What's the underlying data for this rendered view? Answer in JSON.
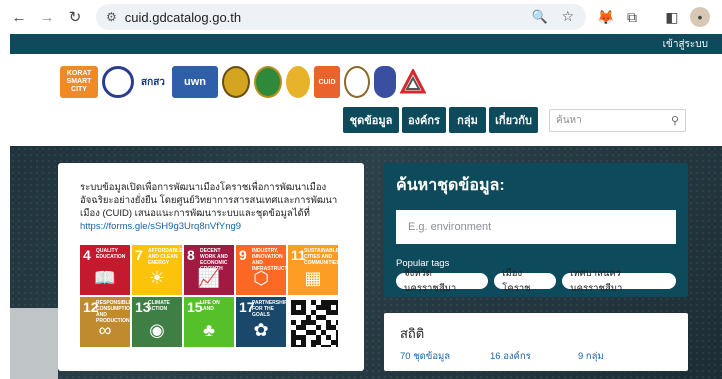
{
  "browser": {
    "url": "cuid.gdcatalog.go.th"
  },
  "site": {
    "login_label": "เข้าสู่ระบบ",
    "logos": [
      "KORAT SMART CITY",
      "university-seal",
      "สกสว",
      "uwn",
      "seal",
      "seal",
      "seal",
      "CUID",
      "logo",
      "shield",
      "triangle"
    ],
    "nav": [
      "ชุดข้อมูล",
      "องค์กร",
      "กลุ่ม",
      "เกี่ยวกับ"
    ],
    "search_placeholder": "ค้นหา"
  },
  "intro": {
    "text": "ระบบข้อมูลเปิดเพื่อการพัฒนาเมืองโคราชเพื่อการพัฒนาเมืองอัจฉริยะอย่างยั่งยืน โดยศูนย์วิทยาการสารสนเทศและการพัฒนาเมือง (CUID) เสนอแนะการพัฒนาระบบและชุดข้อมูลได้ที่",
    "link": "https://forms.gle/sSH9g3Urq8nVfYng9",
    "sdgs": [
      {
        "num": "4",
        "title": "QUALITY EDUCATION",
        "color": "#c5192d",
        "glyph": "📖"
      },
      {
        "num": "7",
        "title": "AFFORDABLE AND CLEAN ENERGY",
        "color": "#fcc30b",
        "glyph": "☀"
      },
      {
        "num": "8",
        "title": "DECENT WORK AND ECONOMIC GROWTH",
        "color": "#a21942",
        "glyph": "📈"
      },
      {
        "num": "9",
        "title": "INDUSTRY, INNOVATION AND INFRASTRUCTURE",
        "color": "#fd6925",
        "glyph": "⬡"
      },
      {
        "num": "11",
        "title": "SUSTAINABLE CITIES AND COMMUNITIES",
        "color": "#fd9d24",
        "glyph": "▦"
      },
      {
        "num": "12",
        "title": "RESPONSIBLE CONSUMPTION AND PRODUCTION",
        "color": "#bf8b2e",
        "glyph": "∞"
      },
      {
        "num": "13",
        "title": "CLIMATE ACTION",
        "color": "#3f7e44",
        "glyph": "◉"
      },
      {
        "num": "15",
        "title": "LIFE ON LAND",
        "color": "#56c02b",
        "glyph": "♣"
      },
      {
        "num": "17",
        "title": "PARTNERSHIPS FOR THE GOALS",
        "color": "#19486a",
        "glyph": "✿"
      }
    ]
  },
  "search": {
    "title": "ค้นหาชุดข้อมูล:",
    "placeholder": "E.g. environment",
    "tags_label": "Popular tags",
    "tags": [
      "จังหวัดนครราชสีมา",
      "เมืองโคราช",
      "เทศบาลนครนครราชสีมา"
    ]
  },
  "stats": {
    "title": "สถิติ",
    "datasets": "70 ชุดข้อมูล",
    "orgs": "16 องค์กร",
    "groups": "9 กลุ่ม"
  }
}
